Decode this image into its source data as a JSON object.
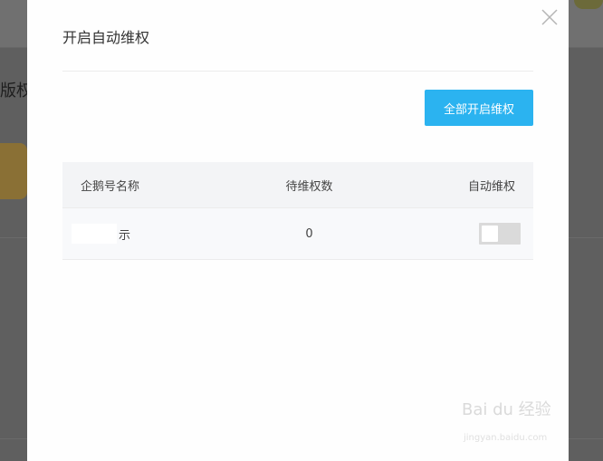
{
  "background": {
    "title_fragment": "版权"
  },
  "modal": {
    "title": "开启自动维权",
    "enable_all_button": "全部开启维权"
  },
  "table": {
    "headers": [
      "企鹅号名称",
      "待维权数",
      "自动维权"
    ],
    "rows": [
      {
        "name": "示",
        "pending": "0",
        "auto_protect": false
      }
    ]
  },
  "watermark": {
    "brand": "Bai du 经验",
    "url": "jingyan.baidu.com"
  },
  "colors": {
    "primary": "#2bb3f0",
    "overlay": "#6e6e6e",
    "toggle_off": "#dadada"
  }
}
